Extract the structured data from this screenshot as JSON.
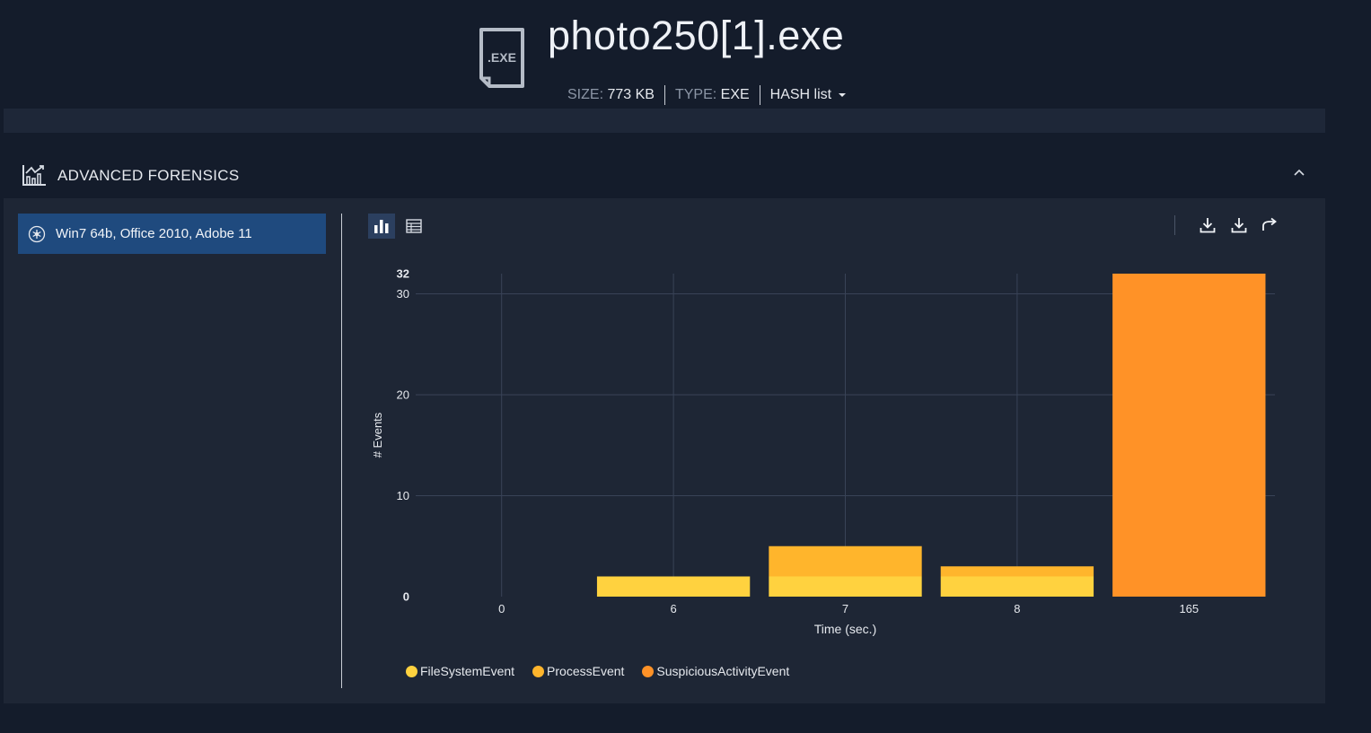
{
  "file": {
    "name": "photo250[1].exe",
    "icon_label": ".EXE",
    "size_label": "SIZE:",
    "size_value": "773 KB",
    "type_label": "TYPE:",
    "type_value": "EXE",
    "hash_label": "HASH list"
  },
  "section": {
    "title": "ADVANCED FORENSICS",
    "icon": "chart-trend-icon"
  },
  "environments": [
    {
      "label": "Win7 64b, Office 2010, Adobe 11",
      "selected": true
    }
  ],
  "toolbar": {
    "view_modes": [
      "bar-chart-icon",
      "table-icon"
    ],
    "active_view": "bar-chart-icon",
    "actions": [
      "download-icon",
      "download-icon",
      "share-icon"
    ]
  },
  "colors": {
    "FileSystemEvent": "#ffd23f",
    "ProcessEvent": "#ffb52c",
    "SuspiciousActivityEvent": "#ff9227",
    "selected_env": "#1f4a7e"
  },
  "chart_data": {
    "type": "bar",
    "stacked": true,
    "categories": [
      "0",
      "6",
      "7",
      "8",
      "165"
    ],
    "series": [
      {
        "name": "FileSystemEvent",
        "values": [
          0,
          2,
          2,
          2,
          0
        ]
      },
      {
        "name": "ProcessEvent",
        "values": [
          0,
          0,
          3,
          1,
          0
        ]
      },
      {
        "name": "SuspiciousActivityEvent",
        "values": [
          0,
          0,
          0,
          0,
          32
        ]
      }
    ],
    "xlabel": "Time (sec.)",
    "ylabel": "# Events",
    "ylim": [
      0,
      32
    ],
    "yticks": [
      0,
      10,
      20,
      30,
      32
    ],
    "grid": true,
    "legend_position": "bottom-left"
  }
}
